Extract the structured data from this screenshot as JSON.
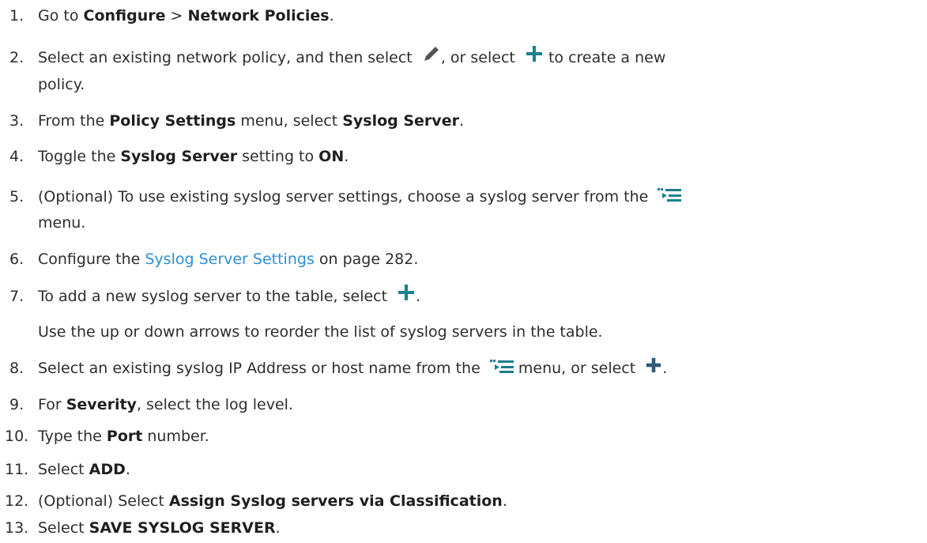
{
  "steps": [
    {
      "num": "1.",
      "parts": [
        "Go to ",
        "Configure",
        " > ",
        "Network Policies",
        "."
      ]
    },
    {
      "num": "2.",
      "parts": [
        "Select an existing network policy, and then select ",
        ", or select ",
        " to create a new",
        "policy."
      ]
    },
    {
      "num": "3.",
      "parts": [
        "From the ",
        "Policy Settings",
        " menu, select ",
        "Syslog Server",
        "."
      ]
    },
    {
      "num": "4.",
      "parts": [
        "Toggle the ",
        "Syslog Server",
        " setting to ",
        "ON",
        "."
      ]
    },
    {
      "num": "5.",
      "parts": [
        "(Optional) To use existing syslog server settings, choose a syslog server from the ",
        "menu."
      ]
    },
    {
      "num": "6.",
      "parts": [
        "Configure the ",
        "Syslog Server Settings",
        " on page 282."
      ]
    },
    {
      "num": "7.",
      "parts": [
        "To add a new syslog server to the table, select ",
        ".",
        "Use the up or down arrows to reorder the list of syslog servers in the table."
      ]
    },
    {
      "num": "8.",
      "parts": [
        "Select an existing syslog IP Address or host name from the ",
        " menu, or select ",
        "."
      ]
    },
    {
      "num": "9.",
      "parts": [
        "For ",
        "Severity",
        ", select the log level."
      ]
    },
    {
      "num": "10.",
      "parts": [
        "Type the ",
        "Port",
        " number."
      ]
    },
    {
      "num": "11.",
      "parts": [
        "Select ",
        "ADD",
        "."
      ]
    },
    {
      "num": "12.",
      "parts": [
        "(Optional) Select ",
        "Assign Syslog servers via Classification",
        "."
      ]
    },
    {
      "num": "13.",
      "parts": [
        "Select ",
        "SAVE SYSLOG SERVER",
        "."
      ]
    }
  ],
  "colors": {
    "text": "#2d2d2d",
    "link": "#2a8fd6",
    "teal_icon": "#1b7f8f",
    "pencil": "#555555"
  },
  "icons": [
    "pencil-edit-icon",
    "plus-icon",
    "select-list-icon"
  ]
}
